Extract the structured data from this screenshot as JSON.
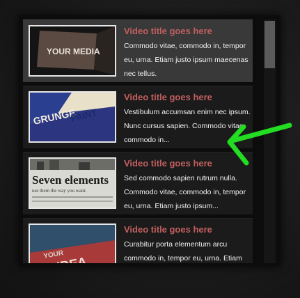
{
  "items": [
    {
      "title": "Video title goes here",
      "desc": "Commodo vitae, commodo in, tempor eu, urna. Etiam justo ipsum maecenas nec tellus.",
      "thumb": "YOUR MEDIA"
    },
    {
      "title": "Video title goes here",
      "desc": "Vestibulum accumsan enim nec ipsum. Nunc cursus sapien. Commodo vitae, commodo in...",
      "thumb": "GRUNGE"
    },
    {
      "title": "Video title goes here",
      "desc": "Sed commodo sapien rutrum nulla. Commodo vitae, commodo in, tempor eu, urna. Etiam justo ipsum...",
      "thumb": "Seven elements"
    },
    {
      "title": "Video title goes here",
      "desc": "Curabitur porta elementum arcu commodo in, tempor eu, urna. Etiam",
      "thumb": "YOUR IDEA"
    }
  ],
  "thumb_text": {
    "t1_a": "YOUR MEDIA",
    "t2_a": "GRUNGE",
    "t2_b": "PAINT",
    "t3_a": "Seven elements",
    "t3_b": "use them the way you want.",
    "t4_a": "YOUR",
    "t4_b": "IDEA"
  },
  "colors": {
    "title": "#c25f5f",
    "arrow": "#22dd22",
    "active_bg": "#393939"
  },
  "annotation": {
    "icon": "green-arrow-icon"
  }
}
